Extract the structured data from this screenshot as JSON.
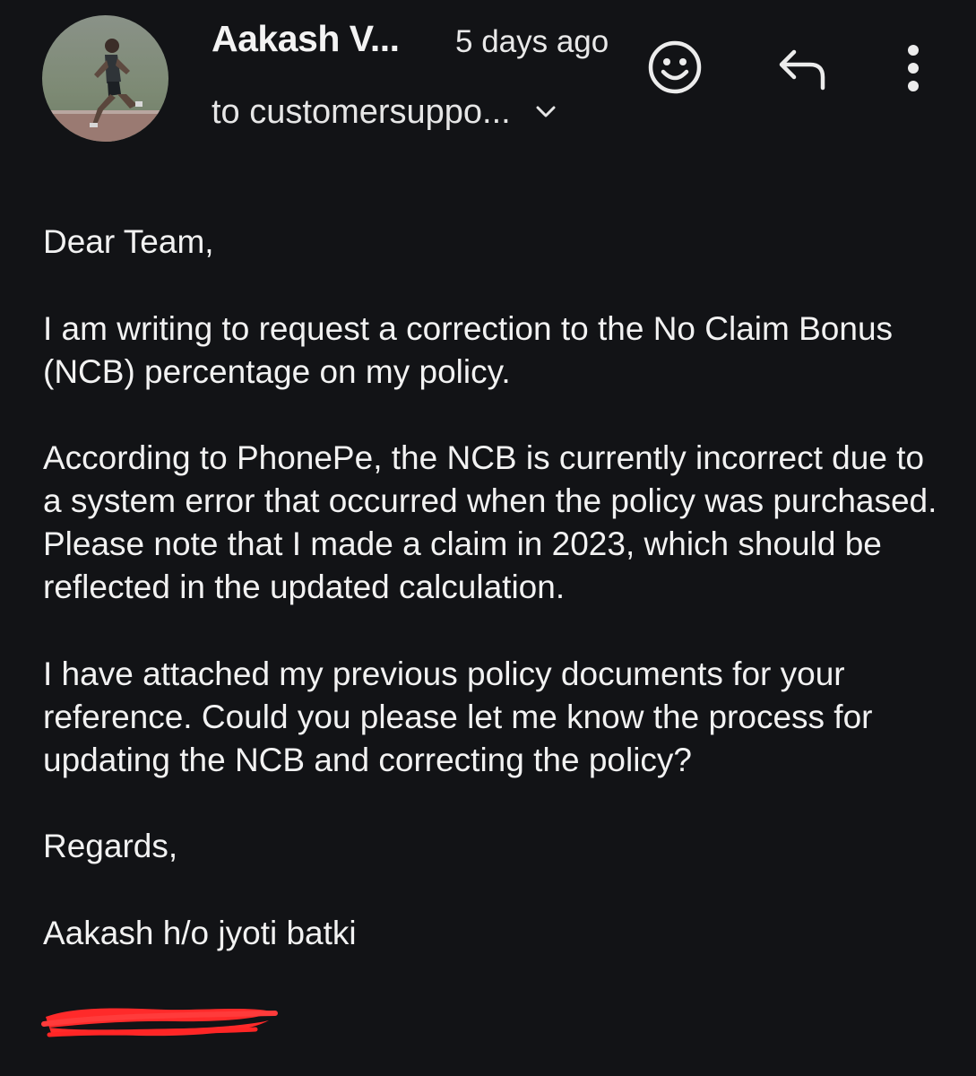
{
  "header": {
    "sender_name": "Aakash V...",
    "timestamp": "5 days ago",
    "recipient": "to customersuppo...",
    "icons": {
      "avatar": "avatar-runner-photo",
      "expand": "chevron-down-icon",
      "emoji": "smiley-icon",
      "reply": "reply-icon",
      "more": "more-vertical-icon"
    }
  },
  "message": {
    "greeting": "Dear Team,",
    "paragraphs": [
      "I am writing to request a correction to the No Claim Bonus (NCB) percentage on my policy.",
      "According to PhonePe, the NCB is currently incorrect due to a system error that occurred when the policy was purchased. Please note that I made a claim in 2023, which should be reflected in the updated calculation.",
      "I have attached my previous policy documents for your reference. Could you please let me know the process for updating the NCB and correcting the policy?"
    ],
    "closing": "Regards,",
    "signature": "Aakash h/o jyoti batki"
  },
  "colors": {
    "background": "#121316",
    "text": "#f2f2f2",
    "redaction": "#ff2d2d"
  }
}
